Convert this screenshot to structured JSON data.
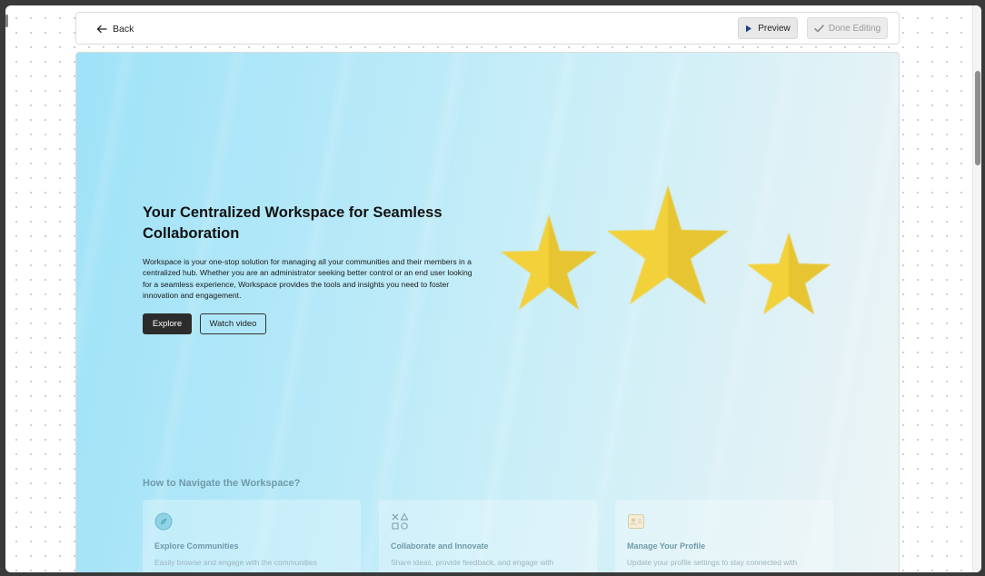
{
  "toolbar": {
    "back_label": "Back",
    "preview_label": "Preview",
    "done_label": "Done Editing"
  },
  "hero": {
    "title": "Your Centralized Workspace for Seamless Collaboration",
    "description": "Workspace is your one-stop solution for managing all your communities and their members in a centralized hub. Whether you are an administrator seeking better control or an end user looking for a seamless experience, Workspace provides the tools and insights you need to foster innovation and engagement.",
    "primary_cta": "Explore",
    "secondary_cta": "Watch video"
  },
  "navigate": {
    "title": "How to Navigate the Workspace?",
    "cards": [
      {
        "icon": "compass-icon",
        "title": "Explore Communities",
        "desc": "Easily browse and engage with the communities"
      },
      {
        "icon": "shapes-icon",
        "title": "Collaborate and Innovate",
        "desc": "Share ideas, provide feedback, and engage with"
      },
      {
        "icon": "profile-card-icon",
        "title": "Manage Your Profile",
        "desc": "Update your profile settings to stay connected with"
      }
    ]
  },
  "colors": {
    "star_fill": "#f2d13a",
    "star_shade": "#d9b52a",
    "primary_button": "#2c2c2c",
    "muted_teal": "#6f9aa8"
  }
}
